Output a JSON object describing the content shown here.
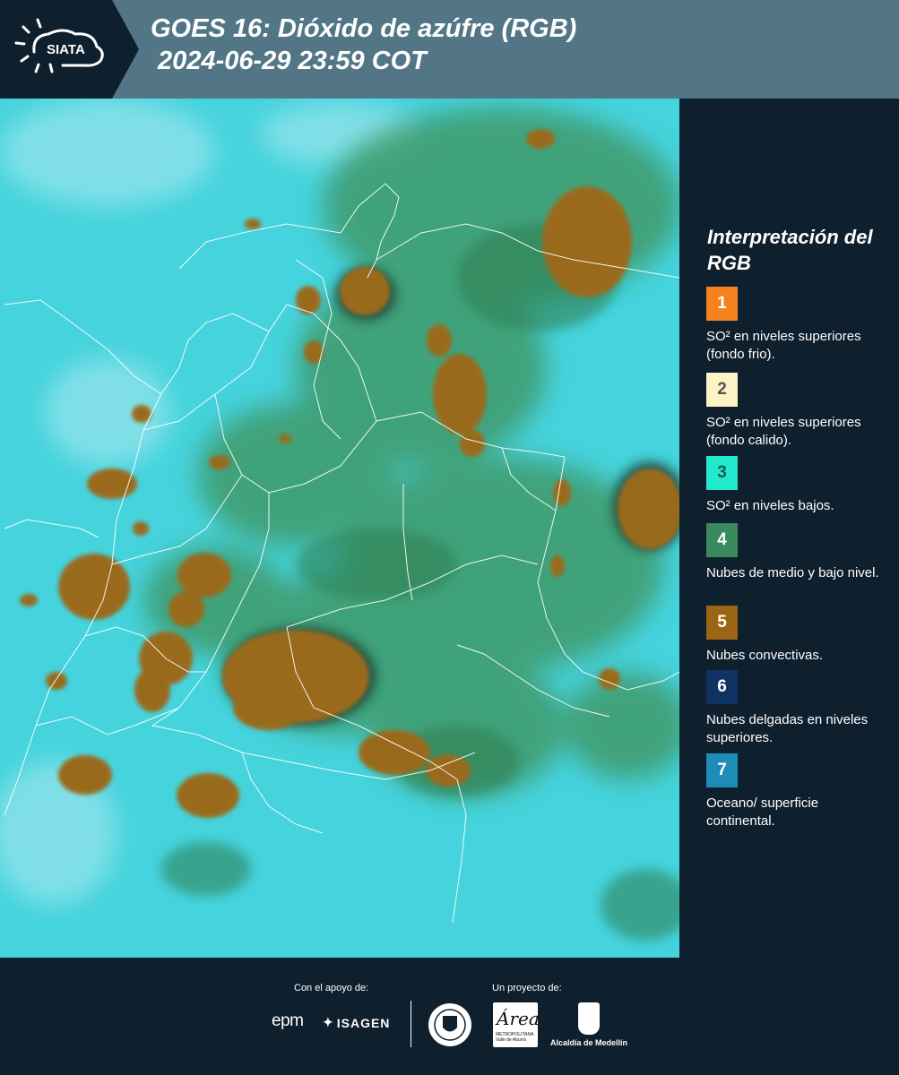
{
  "header": {
    "logo_text": "SIATA",
    "title_line1": "GOES 16: Dióxido de azúfre (RGB)",
    "title_line2": " 2024-06-29 23:59 COT",
    "background_color": "#527686"
  },
  "legend": {
    "title": "Interpretación del RGB",
    "items": [
      {
        "number": "1",
        "label": "SO² en niveles superiores (fondo frio).",
        "color": "#f5821f"
      },
      {
        "number": "2",
        "label": "SO² en niveles superiores (fondo calido).",
        "color": "#fdf4c5"
      },
      {
        "number": "3",
        "label": "SO² en niveles bajos.",
        "color": "#22e8cc"
      },
      {
        "number": "4",
        "label": "Nubes de medio y bajo nivel.",
        "color": "#3a8a5f"
      },
      {
        "number": "5",
        "label": "Nubes convectivas.",
        "color": "#9a6514"
      },
      {
        "number": "6",
        "label": "Nubes delgadas en niveles superiores.",
        "color": "#0f3263"
      },
      {
        "number": "7",
        "label": "Oceano/ superficie continental.",
        "color": "#1d8db7"
      }
    ]
  },
  "footer": {
    "support_label": "Con el apoyo de:",
    "project_label": "Un proyecto de:",
    "sponsor_1": "epm",
    "sponsor_2": "ISAGEN",
    "partner_area": "Área",
    "partner_area_sub": "METROPOLITANA Valle de Aburrá",
    "partner_alcaldia": "Alcaldía de Medellín"
  }
}
